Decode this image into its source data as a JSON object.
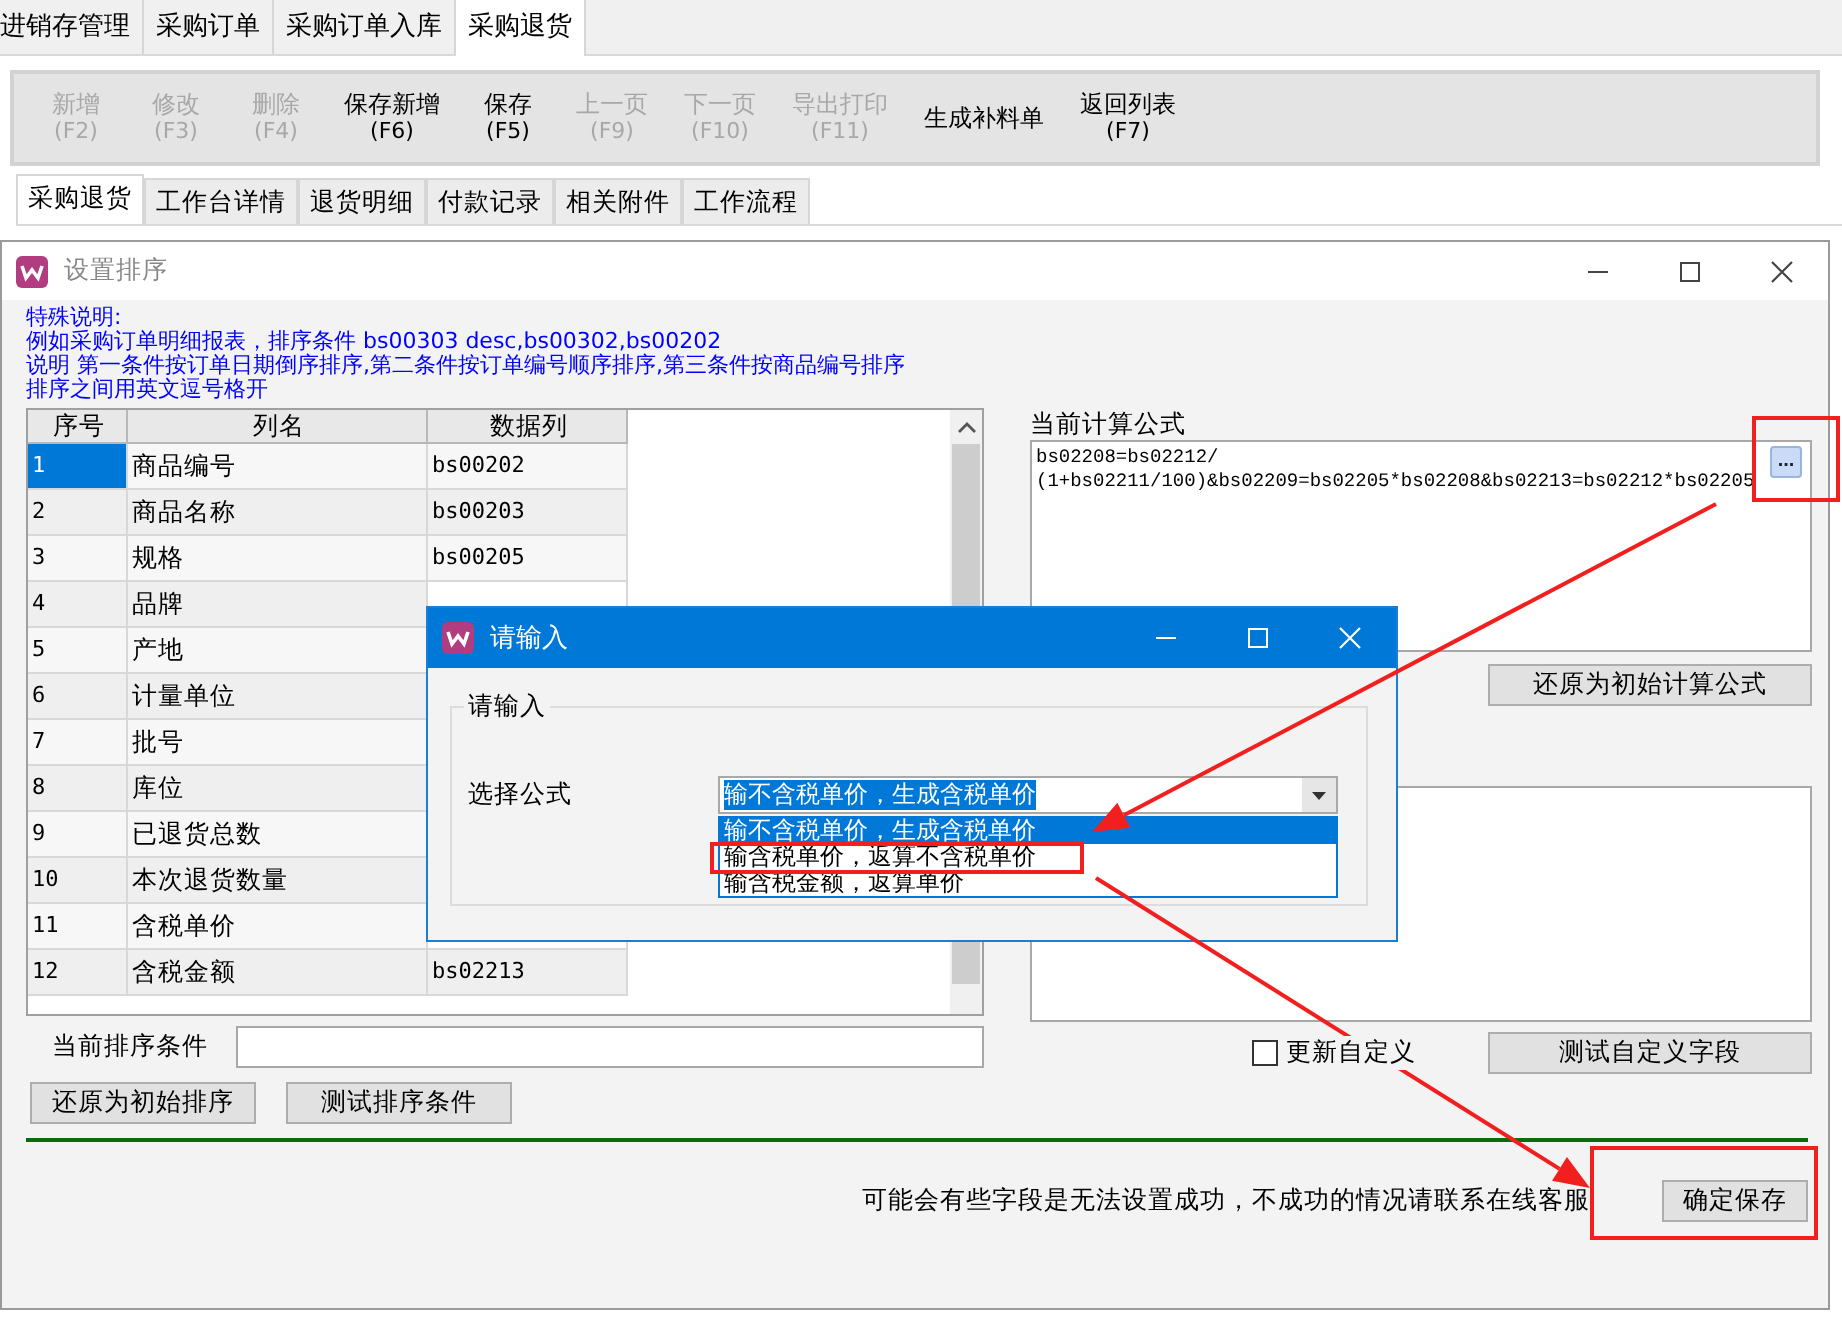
{
  "main_tabs": [
    {
      "label": "进销存管理",
      "selected": false
    },
    {
      "label": "采购订单",
      "selected": false
    },
    {
      "label": "采购订单入库",
      "selected": false
    },
    {
      "label": "采购退货",
      "selected": true
    }
  ],
  "toolbar": [
    {
      "label": "新增",
      "key": "(F2)",
      "disabled": true
    },
    {
      "label": "修改",
      "key": "(F3)",
      "disabled": true
    },
    {
      "label": "删除",
      "key": "(F4)",
      "disabled": true
    },
    {
      "label": "保存新增",
      "key": "(F6)",
      "disabled": false
    },
    {
      "label": "保存",
      "key": "(F5)",
      "disabled": false
    },
    {
      "label": "上一页",
      "key": "(F9)",
      "disabled": true
    },
    {
      "label": "下一页",
      "key": "(F10)",
      "disabled": true
    },
    {
      "label": "导出打印",
      "key": "(F11)",
      "disabled": true
    },
    {
      "label": "生成补料单",
      "disabled": false
    },
    {
      "label": "返回列表",
      "key": "(F7)",
      "disabled": false
    }
  ],
  "sub_tabs": [
    {
      "label": "采购退货",
      "selected": true
    },
    {
      "label": "工作台详情",
      "selected": false
    },
    {
      "label": "退货明细",
      "selected": false
    },
    {
      "label": "付款记录",
      "selected": false
    },
    {
      "label": "相关附件",
      "selected": false
    },
    {
      "label": "工作流程",
      "selected": false
    }
  ],
  "sort_dialog": {
    "title": "设置排序",
    "notes": [
      "特殊说明:",
      "例如采购订单明细报表，排序条件 bs00303 desc,bs00302,bs00202",
      "说明 第一条件按订单日期倒序排序,第二条件按订单编号顺序排序,第三条件按商品编号排序",
      "排序之间用英文逗号格开"
    ],
    "grid": {
      "columns": [
        "序号",
        "列名",
        "数据列"
      ],
      "rows": [
        {
          "no": "1",
          "name": "商品编号",
          "field": "bs00202",
          "selected": true
        },
        {
          "no": "2",
          "name": "商品名称",
          "field": "bs00203",
          "selected": false
        },
        {
          "no": "3",
          "name": "规格",
          "field": "bs00205",
          "selected": false
        },
        {
          "no": "4",
          "name": "品牌",
          "selected": false
        },
        {
          "no": "5",
          "name": "产地",
          "selected": false
        },
        {
          "no": "6",
          "name": "计量单位",
          "selected": false
        },
        {
          "no": "7",
          "name": "批号",
          "selected": false
        },
        {
          "no": "8",
          "name": "库位",
          "selected": false
        },
        {
          "no": "9",
          "name": "已退货总数",
          "selected": false
        },
        {
          "no": "10",
          "name": "本次退货数量",
          "selected": false
        },
        {
          "no": "11",
          "name": "含税单价",
          "selected": false
        },
        {
          "no": "12",
          "name": "含税金额",
          "field": "bs02213",
          "selected": false
        }
      ]
    },
    "sort_condition_label": "当前排序条件",
    "left_buttons": [
      "还原为初始排序",
      "测试排序条件"
    ],
    "formula_label": "当前计算公式",
    "formula_lines": [
      "bs02208=bs02212/",
      "(1+bs02211/100)&bs02209=bs02205*bs02208&bs02213=bs02212*bs02205"
    ],
    "formula_button": "...",
    "restore_formula_button": "还原为初始计算公式",
    "custom_checkbox": {
      "label": "更新自定义",
      "checked": false
    },
    "test_custom_button": "测试自定义字段",
    "footer_note": "可能会有些字段是无法设置成功，不成功的情况请联系在线客服",
    "save_button": "确定保存"
  },
  "input_dialog": {
    "title": "请输入",
    "group_label": "请输入",
    "field_label": "选择公式",
    "combo_value": "输不含税单价，生成含税单价",
    "options": [
      {
        "label": "输不含税单价，生成含税单价",
        "selected": true
      },
      {
        "label": "输含税单价，返算不含税单价",
        "selected": false
      },
      {
        "label": "输含税金额，返算单价",
        "selected": false
      }
    ]
  }
}
